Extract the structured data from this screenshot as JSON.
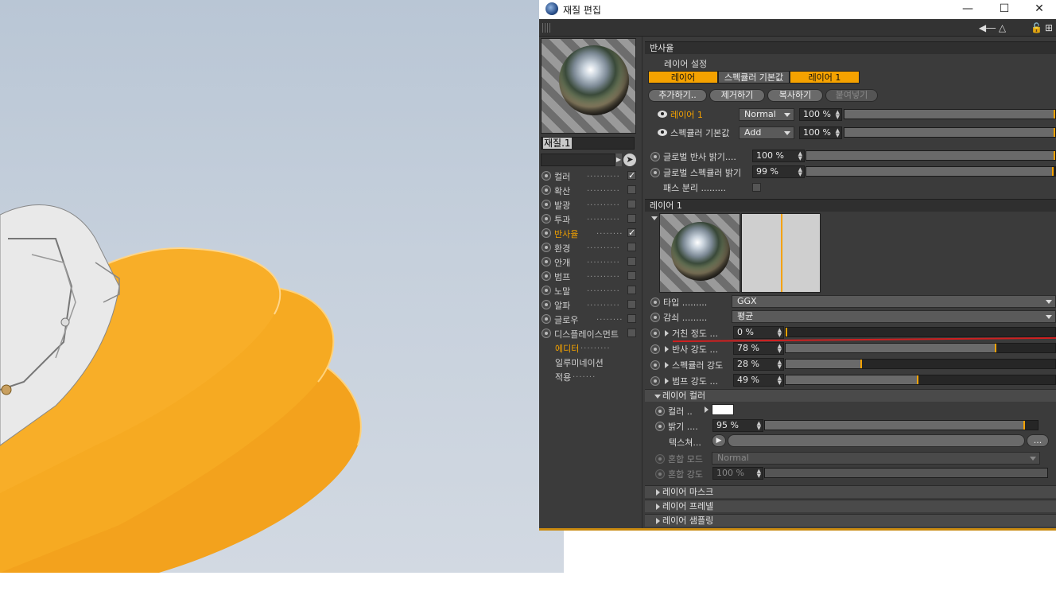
{
  "window": {
    "title": "재질 편집"
  },
  "material": {
    "name": "재질.1"
  },
  "channels": [
    {
      "label": "컬러",
      "dots": "..........",
      "checked": true,
      "active": false
    },
    {
      "label": "확산",
      "dots": "..........",
      "checked": false,
      "active": false
    },
    {
      "label": "발광",
      "dots": "..........",
      "checked": false,
      "active": false
    },
    {
      "label": "투과",
      "dots": "..........",
      "checked": false,
      "active": false
    },
    {
      "label": "반사율",
      "dots": "........",
      "checked": true,
      "active": true
    },
    {
      "label": "환경",
      "dots": "..........",
      "checked": false,
      "active": false
    },
    {
      "label": "안개",
      "dots": "..........",
      "checked": false,
      "active": false
    },
    {
      "label": "범프",
      "dots": "..........",
      "checked": false,
      "active": false
    },
    {
      "label": "노말",
      "dots": "..........",
      "checked": false,
      "active": false
    },
    {
      "label": "알파",
      "dots": "..........",
      "checked": false,
      "active": false
    },
    {
      "label": "글로우",
      "dots": "........",
      "checked": false,
      "active": false
    },
    {
      "label": "디스플레이스먼트",
      "dots": "",
      "checked": false,
      "active": false
    }
  ],
  "extra_items": [
    {
      "label": "에디터",
      "dots": ".........",
      "active": true
    },
    {
      "label": "일루미네이션",
      "dots": "",
      "active": false
    },
    {
      "label": "적용",
      "dots": ".......",
      "active": false
    }
  ],
  "reflectance": {
    "header": "반사율",
    "layer_settings_label": "레이어 설정",
    "tabs": [
      "레이어",
      "스펙큘러 기본값",
      "레이어 1"
    ],
    "buttons": {
      "add": "추가하기..",
      "remove": "제거하기",
      "copy": "복사하기",
      "paste": "붙여넣기"
    },
    "layers": [
      {
        "name": "레이어 1",
        "mode": "Normal",
        "opacity": "100 %",
        "value": 1.0
      },
      {
        "name": "스펙큘러 기본값",
        "mode": "Add",
        "opacity": "100 %",
        "value": 1.0
      }
    ],
    "global_reflection_brightness": {
      "label": "글로벌 반사 밝기",
      "dots": "....",
      "value": "100 %",
      "fraction": 1.0
    },
    "global_specular_brightness": {
      "label": "글로벌 스펙큘러 밝기",
      "value": "99 %",
      "fraction": 0.99
    },
    "pass_separation": {
      "label": "패스 분리",
      "dots": "........."
    }
  },
  "layer1": {
    "header": "레이어 1",
    "type": {
      "label": "타입",
      "dots": ".........",
      "value": "GGX"
    },
    "attenuation": {
      "label": "감쇠",
      "dots": ".........",
      "value": "평균"
    },
    "roughness": {
      "label": "거친 정도",
      "dots": "...",
      "value": "0 %",
      "fraction": 0.0
    },
    "reflection_strength": {
      "label": "반사 강도",
      "dots": "...",
      "value": "78 %",
      "fraction": 0.78
    },
    "specular_strength": {
      "label": "스펙큘러 강도",
      "value": "28 %",
      "fraction": 0.28
    },
    "bump_strength": {
      "label": "범프 강도",
      "dots": "...",
      "value": "49 %",
      "fraction": 0.49
    }
  },
  "layer_color": {
    "header": "레이어 컬러",
    "color": {
      "label": "컬러",
      "dots": "..",
      "swatch": "#ffffff"
    },
    "brightness": {
      "label": "밝기",
      "dots": "....",
      "value": "95 %",
      "fraction": 0.95
    },
    "texture": {
      "label": "텍스쳐",
      "dots": "...",
      "browse": "..."
    },
    "blend_mode": {
      "label": "혼합 모드",
      "value": "Normal"
    },
    "blend_strength": {
      "label": "혼합 강도",
      "value": "100 %",
      "fraction": 1.0
    }
  },
  "collapsed_sections": [
    "레이어 마스크",
    "레이어 프레넬",
    "레이어 샘플링"
  ],
  "colors": {
    "accent": "#f5a200",
    "panel": "#3b3b3b",
    "model": "#f5a623"
  }
}
